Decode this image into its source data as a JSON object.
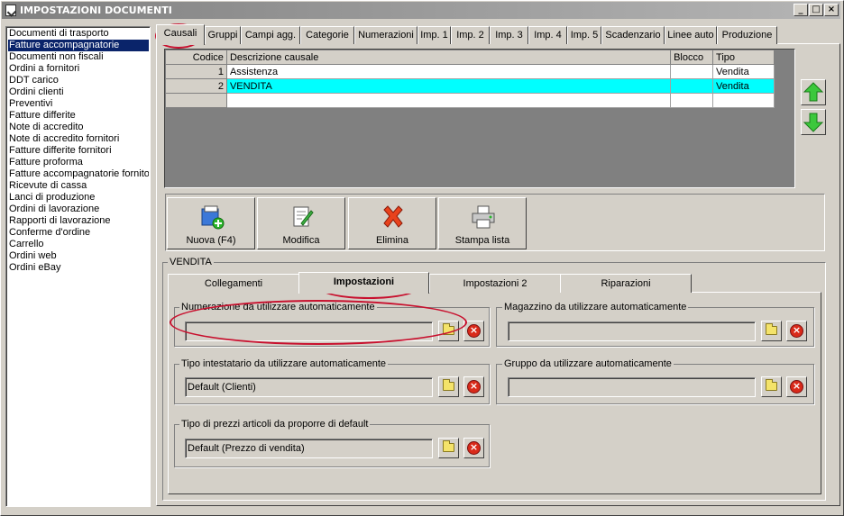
{
  "window": {
    "title": "IMPOSTAZIONI DOCUMENTI",
    "minimize": "_",
    "maximize": "□",
    "close": "×"
  },
  "sidebar": {
    "items": [
      {
        "label": "Documenti di trasporto",
        "selected": false
      },
      {
        "label": "Fatture accompagnatorie",
        "selected": true
      },
      {
        "label": "Documenti non fiscali",
        "selected": false
      },
      {
        "label": "Ordini a fornitori",
        "selected": false
      },
      {
        "label": "DDT carico",
        "selected": false
      },
      {
        "label": "Ordini clienti",
        "selected": false
      },
      {
        "label": "Preventivi",
        "selected": false
      },
      {
        "label": "Fatture differite",
        "selected": false
      },
      {
        "label": "Note di accredito",
        "selected": false
      },
      {
        "label": "Note di accredito fornitori",
        "selected": false
      },
      {
        "label": "Fatture differite fornitori",
        "selected": false
      },
      {
        "label": "Fatture proforma",
        "selected": false
      },
      {
        "label": "Fatture accompagnatorie fornitori",
        "selected": false
      },
      {
        "label": "Ricevute di cassa",
        "selected": false
      },
      {
        "label": "Lanci di produzione",
        "selected": false
      },
      {
        "label": "Ordini di lavorazione",
        "selected": false
      },
      {
        "label": "Rapporti di lavorazione",
        "selected": false
      },
      {
        "label": "Conferme d'ordine",
        "selected": false
      },
      {
        "label": "Carrello",
        "selected": false
      },
      {
        "label": "Ordini web",
        "selected": false
      },
      {
        "label": "Ordini eBay",
        "selected": false
      }
    ]
  },
  "tabs": [
    {
      "label": "Causali",
      "active": true
    },
    {
      "label": "Gruppi"
    },
    {
      "label": "Campi agg."
    },
    {
      "label": "Categorie"
    },
    {
      "label": "Numerazioni"
    },
    {
      "label": "Imp. 1"
    },
    {
      "label": "Imp. 2"
    },
    {
      "label": "Imp. 3"
    },
    {
      "label": "Imp. 4"
    },
    {
      "label": "Imp. 5"
    },
    {
      "label": "Scadenzario"
    },
    {
      "label": "Linee auto"
    },
    {
      "label": "Produzione"
    }
  ],
  "grid": {
    "columns": [
      "Codice",
      "Descrizione causale",
      "Blocco",
      "Tipo"
    ],
    "rows": [
      {
        "codice": "1",
        "descrizione": "Assistenza",
        "blocco": "",
        "tipo": "Vendita"
      },
      {
        "codice": "2",
        "descrizione": "VENDITA",
        "blocco": "",
        "tipo": "Vendita",
        "highlight": true
      }
    ]
  },
  "side_buttons": {
    "up_icon": "arrow-up-icon",
    "down_icon": "arrow-down-icon"
  },
  "toolbar": {
    "new_label": "Nuova (F4)",
    "edit_label": "Modifica",
    "delete_label": "Elimina",
    "print_label": "Stampa lista"
  },
  "detail": {
    "group_title": "VENDITA",
    "subtabs": [
      {
        "label": "Collegamenti"
      },
      {
        "label": "Impostazioni",
        "active": true
      },
      {
        "label": "Impostazioni 2"
      },
      {
        "label": "Riparazioni"
      }
    ],
    "fields": {
      "numerazione": {
        "label": "Numerazione da utilizzare automaticamente",
        "value": ""
      },
      "magazzino": {
        "label": "Magazzino da utilizzare automaticamente",
        "value": ""
      },
      "tipo_intestatario": {
        "label": "Tipo intestatario da utilizzare automaticamente",
        "value": "Default (Clienti)"
      },
      "gruppo": {
        "label": "Gruppo da utilizzare automaticamente",
        "value": ""
      },
      "tipo_prezzi": {
        "label": "Tipo di prezzi articoli da proporre di default",
        "value": "Default (Prezzo di vendita)"
      }
    }
  },
  "colors": {
    "selection": "#0a246a",
    "row_highlight": "#00ffff",
    "annotation": "#c8102e",
    "grid_background": "#808080"
  }
}
